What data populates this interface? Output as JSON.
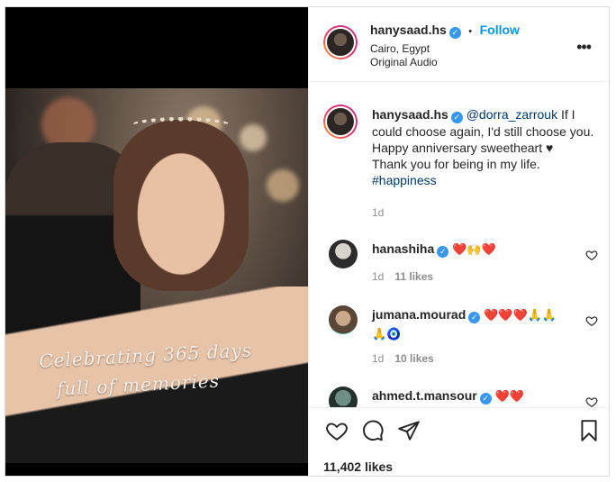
{
  "post": {
    "username": "hanysaad.hs",
    "verified_mark": "✓",
    "follow_label": "Follow",
    "separator": "•",
    "location": "Cairo, Egypt",
    "audio": "Original Audio",
    "more_icon": "more-horizontal-icon",
    "overlay_text_line1": "Celebrating 365 days",
    "overlay_text_line2": "full of memories"
  },
  "caption": {
    "username": "hanysaad.hs",
    "mention": "@dorra_zarrouk",
    "text1": " If I could choose again, I'd still choose you. Happy anniversary sweetheart ♥",
    "text2": "Thank you for being in my life.",
    "hashtag": "#happiness",
    "time": "1d"
  },
  "comments": [
    {
      "username": "hanashiha",
      "text": "❤️🙌❤️",
      "time": "1d",
      "likes": "11 likes"
    },
    {
      "username": "jumana.mourad",
      "text": "❤️❤️❤️🙏🙏 🙏🧿",
      "time": "1d",
      "likes": "10 likes"
    },
    {
      "username": "ahmed.t.mansour",
      "text": "❤️❤️",
      "time": "",
      "likes": ""
    }
  ],
  "footer": {
    "likes": "11,402 likes",
    "icons": [
      "heart-icon",
      "comment-icon",
      "share-icon",
      "bookmark-icon"
    ]
  },
  "colors": {
    "accent": "#0095f6",
    "verified": "#3897f0",
    "border": "#dbdbdb",
    "muted": "#8e8e8e"
  }
}
